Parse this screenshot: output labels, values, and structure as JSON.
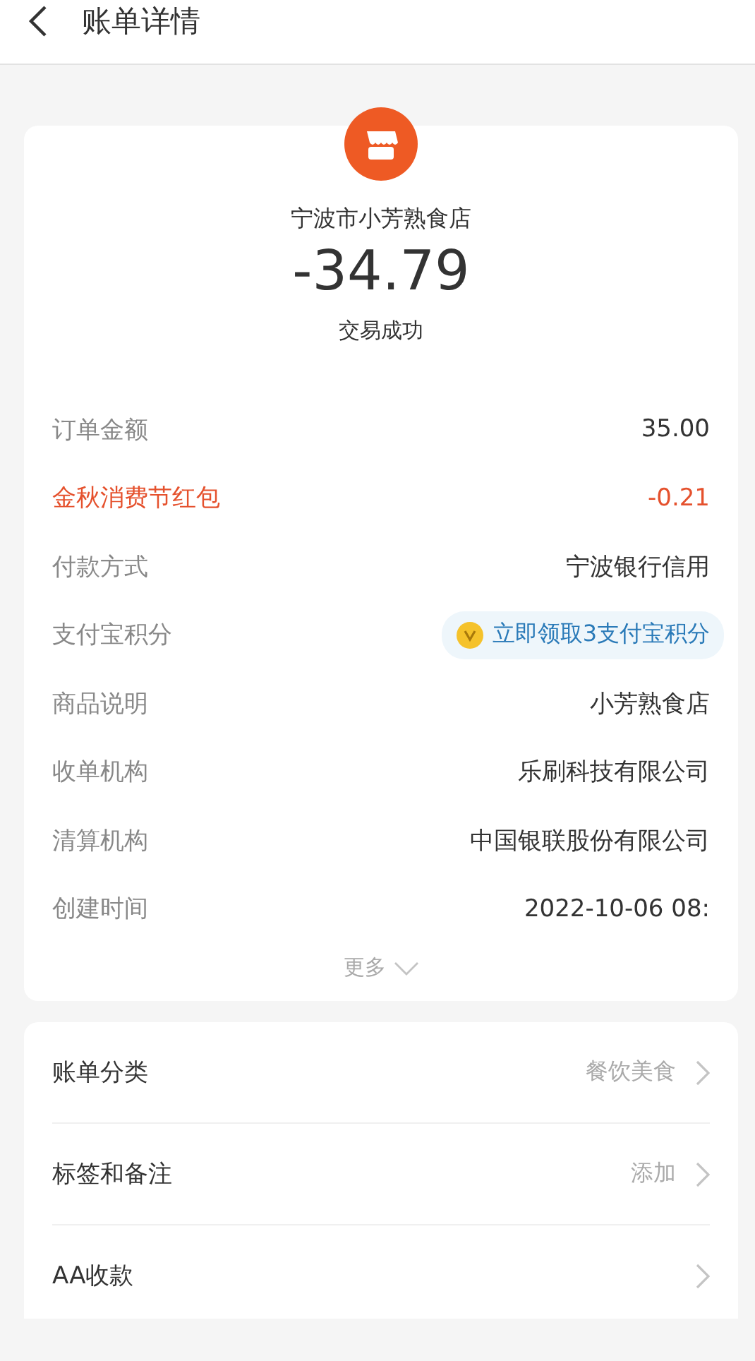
{
  "header": {
    "title": "账单详情"
  },
  "summary": {
    "merchant": "宁波市小芳熟食店",
    "amount": "-34.79",
    "status": "交易成功"
  },
  "details": [
    {
      "kind": "text",
      "label": "订单金额",
      "value": "35.00"
    },
    {
      "kind": "discount",
      "label": "金秋消费节红包",
      "value": "-0.21"
    },
    {
      "kind": "text",
      "label": "付款方式",
      "value": "宁波银行信用"
    },
    {
      "kind": "points",
      "label": "支付宝积分",
      "value": "立即领取3支付宝积分"
    },
    {
      "kind": "text",
      "label": "商品说明",
      "value": "小芳熟食店"
    },
    {
      "kind": "text",
      "label": "收单机构",
      "value": "乐刷科技有限公司"
    },
    {
      "kind": "text",
      "label": "清算机构",
      "value": "中国银联股份有限公司"
    },
    {
      "kind": "text",
      "label": "创建时间",
      "value": "2022-10-06 08:"
    }
  ],
  "more": "更多",
  "actions": [
    {
      "label": "账单分类",
      "value": "餐饮美食"
    },
    {
      "label": "标签和备注",
      "value": "添加"
    },
    {
      "label": "AA收款"
    }
  ]
}
